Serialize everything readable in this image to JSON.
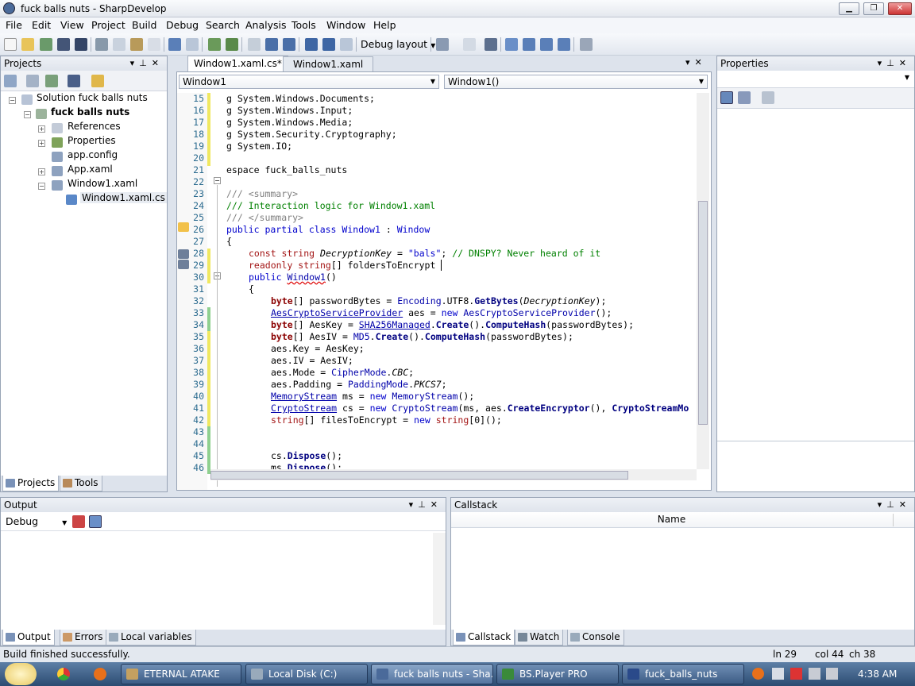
{
  "window": {
    "title": "fuck balls nuts - SharpDevelop",
    "min": "▁",
    "max": "❐",
    "close": "✕"
  },
  "menu": [
    "File",
    "Edit",
    "View",
    "Project",
    "Build",
    "Debug",
    "Search",
    "Analysis",
    "Tools",
    "Window",
    "Help"
  ],
  "toolbar": {
    "layout_label": "Debug layout"
  },
  "projects": {
    "title": "Projects",
    "tree": {
      "solution": "Solution fuck balls nuts",
      "project": "fuck balls nuts",
      "references": "References",
      "properties": "Properties",
      "appconfig": "app.config",
      "appxaml": "App.xaml",
      "window1": "Window1.xaml",
      "window1cs": "Window1.xaml.cs"
    },
    "tabs": {
      "projects": "Projects",
      "tools": "Tools"
    }
  },
  "editor": {
    "tabs": {
      "active": "Window1.xaml.cs*",
      "other": "Window1.xaml"
    },
    "class_combo": "Window1",
    "member_combo": "Window1()",
    "line_numbers": [
      "15",
      "16",
      "17",
      "18",
      "19",
      "20",
      "21",
      "22",
      "23",
      "24",
      "25",
      "26",
      "27",
      "28",
      "29",
      "30",
      "31",
      "32",
      "33",
      "34",
      "35",
      "36",
      "37",
      "38",
      "39",
      "40",
      "41",
      "42",
      "43",
      "44",
      "45",
      "46"
    ],
    "code": {
      "l15": "g System.Windows.Documents;",
      "l16": "g System.Windows.Input;",
      "l17": "g System.Windows.Media;",
      "l18": "g System.Security.Cryptography;",
      "l19": "g System.IO;",
      "l21": "espace fuck_balls_nuts",
      "l23": "/// <summary>",
      "l24": "/// Interaction logic for Window1.xaml",
      "l25": "/// </summary>",
      "l26a": "public partial class",
      "l26b": "Window1",
      "l26c": ":",
      "l26d": "Window",
      "l27": "{",
      "l28a": "const string",
      "l28b": "DecryptionKey",
      "l28c": "=",
      "l28d": "\"bals\"",
      "l28e": ";",
      "l28f": "// DNSPY? Never heard of it",
      "l29a": "readonly string",
      "l29b": "[] foldersToEncrypt",
      "l30a": "public",
      "l30b": "Window1",
      "l30c": "()",
      "l31": "{",
      "l32a": "byte",
      "l32b": "[] passwordBytes = ",
      "l32c": "Encoding",
      "l32d": ".UTF8.",
      "l32e": "GetBytes",
      "l32f": "(",
      "l32g": "DecryptionKey",
      "l32h": ");",
      "l33a": "AesCryptoServiceProvider",
      "l33b": " aes = ",
      "l33c": "new",
      "l33d": " AesCryptoServiceProvider",
      "l33e": "();",
      "l34a": "byte",
      "l34b": "[] AesKey = ",
      "l34c": "SHA256Managed",
      "l34d": ".",
      "l34e": "Create",
      "l34f": "().",
      "l34g": "ComputeHash",
      "l34h": "(passwordBytes);",
      "l35a": "byte",
      "l35b": "[] AesIV = ",
      "l35c": "MD5",
      "l35d": ".",
      "l35e": "Create",
      "l35f": "().",
      "l35g": "ComputeHash",
      "l35h": "(passwordBytes);",
      "l36": "aes.Key = AesKey;",
      "l37": "aes.IV = AesIV;",
      "l38a": "aes.Mode = ",
      "l38b": "CipherMode",
      "l38c": ".",
      "l38d": "CBC",
      "l38e": ";",
      "l39a": "aes.Padding = ",
      "l39b": "PaddingMode",
      "l39c": ".",
      "l39d": "PKCS7",
      "l39e": ";",
      "l40a": "MemoryStream",
      "l40b": " ms = ",
      "l40c": "new",
      "l40d": " MemoryStream",
      "l40e": "();",
      "l41a": "CryptoStream",
      "l41b": " cs = ",
      "l41c": "new",
      "l41d": " CryptoStream",
      "l41e": "(ms, aes.",
      "l41f": "CreateEncryptor",
      "l41g": "(), ",
      "l41h": "CryptoStreamMo",
      "l42a": "string",
      "l42b": "[] filesToEncrypt = ",
      "l42c": "new",
      "l42d": " string",
      "l42e": "[0]();",
      "l45a": "cs.",
      "l45b": "Dispose",
      "l45c": "();",
      "l46a": "ms.",
      "l46b": "Dispose",
      "l46c": "();"
    }
  },
  "properties_panel": {
    "title": "Properties"
  },
  "output": {
    "title": "Output",
    "combo": "Debug",
    "tabs": {
      "output": "Output",
      "errors": "Errors",
      "locals": "Local variables"
    }
  },
  "callstack": {
    "title": "Callstack",
    "col_name": "Name",
    "tabs": {
      "callstack": "Callstack",
      "watch": "Watch",
      "console": "Console"
    }
  },
  "status": {
    "message": "Build finished successfully.",
    "ln": "ln 29",
    "col": "col 44",
    "ch": "ch 38"
  },
  "taskbar": {
    "items": [
      "ETERNAL ATAKE",
      "Local Disk (C:)",
      "fuck balls nuts - Sha...",
      "BS.Player PRO",
      "fuck_balls_nuts"
    ],
    "clock": "4:38 AM"
  },
  "colors": {
    "accent": "#3d5d86",
    "keyword": "#0000cc",
    "comment": "#008000"
  }
}
